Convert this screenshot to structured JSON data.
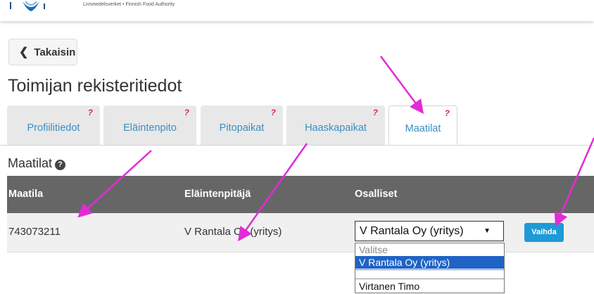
{
  "header": {
    "agency": "Livsmedelsverket",
    "agency_en": "Finnish Food Authority"
  },
  "back_button": {
    "label": "Takaisin"
  },
  "page_title": "Toimijan rekisteritiedot",
  "tabs": [
    {
      "label": "Profiilitiedot",
      "badge": "?"
    },
    {
      "label": "Eläintenpito",
      "badge": "?"
    },
    {
      "label": "Pitopaikat",
      "badge": "?"
    },
    {
      "label": "Haaskapaikat",
      "badge": "?"
    },
    {
      "label": "Maatilat",
      "badge": "?",
      "active": true
    }
  ],
  "section": {
    "title": "Maatilat",
    "help_icon": "?"
  },
  "table": {
    "columns": [
      "Maatila",
      "Eläintenpitäjä",
      "Osalliset"
    ],
    "rows": [
      {
        "maatila": "743073211",
        "elaintenpitaja": "V Rantala Oy (yritys)",
        "osalliset_selected": "V Rantala Oy (yritys)",
        "action": "Vaihda"
      }
    ]
  },
  "dropdown": {
    "options": [
      "Valitse",
      "V Rantala Oy (yritys)",
      "",
      "Virtanen Timo"
    ],
    "highlighted": "V Rantala Oy (yritys)"
  },
  "colors": {
    "arrow": "#e22bd6",
    "accent": "#1e9ad6",
    "tab_text": "#3a8fc4",
    "badge": "#d8245c"
  }
}
